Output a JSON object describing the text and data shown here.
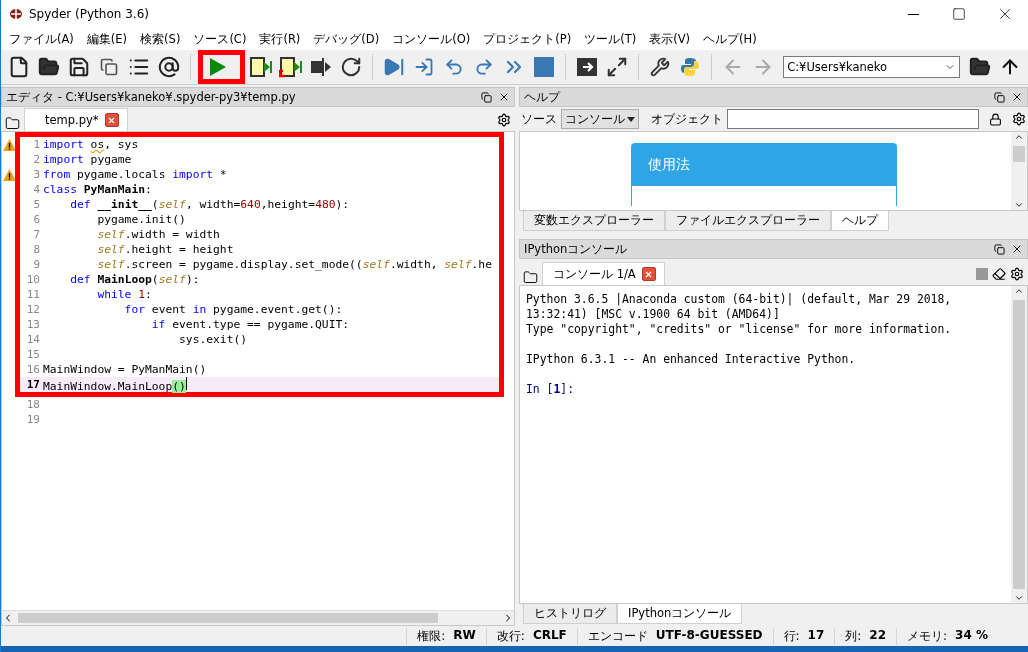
{
  "window": {
    "title": "Spyder (Python 3.6)"
  },
  "menu": [
    "ファイル(A)",
    "編集(E)",
    "検索(S)",
    "ソース(C)",
    "実行(R)",
    "デバッグ(D)",
    "コンソール(O)",
    "プロジェクト(P)",
    "ツール(T)",
    "表示(V)",
    "ヘルプ(H)"
  ],
  "toolbar": {
    "run_highlighted": true,
    "path": "C:¥Users¥kaneko"
  },
  "editor": {
    "title": "エディタ - C:¥Users¥kaneko¥.spyder-py3¥temp.py",
    "tabs": [
      {
        "label": "temp.py*",
        "selected": true
      }
    ],
    "lines": [
      {
        "number": "1",
        "warning": true,
        "current": false,
        "boxed": true,
        "tokens": [
          {
            "kind": "kw",
            "text": "import "
          },
          {
            "kind": "warn",
            "text": "os"
          },
          {
            "kind": "plain",
            "text": ", sys"
          }
        ]
      },
      {
        "number": "2",
        "warning": false,
        "current": false,
        "boxed": true,
        "tokens": [
          {
            "kind": "kw",
            "text": "import "
          },
          {
            "kind": "plain",
            "text": "pygame"
          }
        ]
      },
      {
        "number": "3",
        "warning": true,
        "current": false,
        "boxed": true,
        "tokens": [
          {
            "kind": "kw",
            "text": "from "
          },
          {
            "kind": "plain",
            "text": "pygame.locals "
          },
          {
            "kind": "kw",
            "text": "import "
          },
          {
            "kind": "plain",
            "text": "*"
          }
        ]
      },
      {
        "number": "4",
        "warning": false,
        "current": false,
        "boxed": true,
        "tokens": [
          {
            "kind": "kw",
            "text": "class "
          },
          {
            "kind": "bold",
            "text": "PyManMain"
          },
          {
            "kind": "plain",
            "text": ":"
          }
        ]
      },
      {
        "number": "5",
        "warning": false,
        "current": false,
        "boxed": true,
        "tokens": [
          {
            "kind": "kw",
            "text": "    def "
          },
          {
            "kind": "bold",
            "text": "__init__"
          },
          {
            "kind": "plain",
            "text": "("
          },
          {
            "kind": "self",
            "text": "self"
          },
          {
            "kind": "plain",
            "text": ", width="
          },
          {
            "kind": "num",
            "text": "640"
          },
          {
            "kind": "plain",
            "text": ",height="
          },
          {
            "kind": "num",
            "text": "480"
          },
          {
            "kind": "plain",
            "text": "):"
          }
        ]
      },
      {
        "number": "6",
        "warning": false,
        "current": false,
        "boxed": true,
        "tokens": [
          {
            "kind": "plain",
            "text": "        pygame.init()"
          }
        ]
      },
      {
        "number": "7",
        "warning": false,
        "current": false,
        "boxed": true,
        "tokens": [
          {
            "kind": "self",
            "text": "        self"
          },
          {
            "kind": "plain",
            "text": ".width = width"
          }
        ]
      },
      {
        "number": "8",
        "warning": false,
        "current": false,
        "boxed": true,
        "tokens": [
          {
            "kind": "self",
            "text": "        self"
          },
          {
            "kind": "plain",
            "text": ".height = height"
          }
        ]
      },
      {
        "number": "9",
        "warning": false,
        "current": false,
        "boxed": true,
        "tokens": [
          {
            "kind": "self",
            "text": "        self"
          },
          {
            "kind": "plain",
            "text": ".screen = pygame.display.set_mode(("
          },
          {
            "kind": "self",
            "text": "self"
          },
          {
            "kind": "plain",
            "text": ".width, "
          },
          {
            "kind": "self",
            "text": "self"
          },
          {
            "kind": "plain",
            "text": ".he"
          }
        ]
      },
      {
        "number": "10",
        "warning": false,
        "current": false,
        "boxed": true,
        "tokens": [
          {
            "kind": "kw",
            "text": "    def "
          },
          {
            "kind": "bold",
            "text": "MainLoop"
          },
          {
            "kind": "plain",
            "text": "("
          },
          {
            "kind": "self",
            "text": "self"
          },
          {
            "kind": "plain",
            "text": "):"
          }
        ]
      },
      {
        "number": "11",
        "warning": false,
        "current": false,
        "boxed": true,
        "tokens": [
          {
            "kind": "kw",
            "text": "        while "
          },
          {
            "kind": "num",
            "text": "1"
          },
          {
            "kind": "plain",
            "text": ":"
          }
        ]
      },
      {
        "number": "12",
        "warning": false,
        "current": false,
        "boxed": true,
        "tokens": [
          {
            "kind": "kw",
            "text": "            for "
          },
          {
            "kind": "plain",
            "text": "event "
          },
          {
            "kind": "kw",
            "text": "in "
          },
          {
            "kind": "plain",
            "text": "pygame.event.get():"
          }
        ]
      },
      {
        "number": "13",
        "warning": false,
        "current": false,
        "boxed": true,
        "tokens": [
          {
            "kind": "kw",
            "text": "                if "
          },
          {
            "kind": "plain",
            "text": "event.type == pygame.QUIT:"
          }
        ]
      },
      {
        "number": "14",
        "warning": false,
        "current": false,
        "boxed": true,
        "tokens": [
          {
            "kind": "plain",
            "text": "                    sys.exit()"
          }
        ]
      },
      {
        "number": "15",
        "warning": false,
        "current": false,
        "boxed": true
      },
      {
        "number": "16",
        "warning": false,
        "current": false,
        "boxed": true,
        "tokens": [
          {
            "kind": "plain",
            "text": "MainWindow = PyManMain()"
          }
        ]
      },
      {
        "number": "17",
        "warning": false,
        "current": true,
        "boxed": true,
        "tokens": [
          {
            "kind": "plain",
            "text": "MainWindow.MainLoop"
          },
          {
            "kind": "match",
            "text": "()"
          }
        ]
      },
      {
        "number": "18",
        "warning": false,
        "current": false,
        "boxed": false
      },
      {
        "number": "19",
        "warning": false,
        "current": false,
        "boxed": false
      }
    ]
  },
  "help": {
    "title": "ヘルプ",
    "source_label": "ソース",
    "source_value": "コンソール",
    "object_label": "オブジェクト",
    "card_title": "使用法",
    "tabs": [
      {
        "label": "変数エクスプローラー",
        "selected": false
      },
      {
        "label": "ファイルエクスプローラー",
        "selected": false
      },
      {
        "label": "ヘルプ",
        "selected": true
      }
    ]
  },
  "console": {
    "title": "IPythonコンソール",
    "tabs": [
      {
        "label": "コンソール 1/A",
        "selected": true
      }
    ],
    "lines": [
      {
        "kind": "output",
        "text": "Python 3.6.5 |Anaconda custom (64-bit)| (default, Mar 29 2018,"
      },
      {
        "kind": "output",
        "text": "13:32:41) [MSC v.1900 64 bit (AMD64)]"
      },
      {
        "kind": "output",
        "text": "Type \"copyright\", \"credits\" or \"license\" for more information."
      },
      {
        "kind": "blank"
      },
      {
        "kind": "output",
        "text": "IPython 6.3.1 -- An enhanced Interactive Python."
      },
      {
        "kind": "blank"
      },
      {
        "kind": "prompt",
        "text": "In [**1**]:"
      }
    ],
    "bottom_tabs": [
      {
        "label": "ヒストリログ",
        "selected": false
      },
      {
        "label": "IPythonコンソール",
        "selected": true
      }
    ]
  },
  "status_bar": [
    {
      "label": "権限:",
      "value": "RW"
    },
    {
      "label": "改行:",
      "value": "CRLF"
    },
    {
      "label": "エンコード",
      "value": "UTF-8-GUESSED"
    },
    {
      "label": "行:",
      "value": "17"
    },
    {
      "label": "列:",
      "value": "22"
    },
    {
      "label": "メモリ:",
      "value": "34 %"
    }
  ]
}
